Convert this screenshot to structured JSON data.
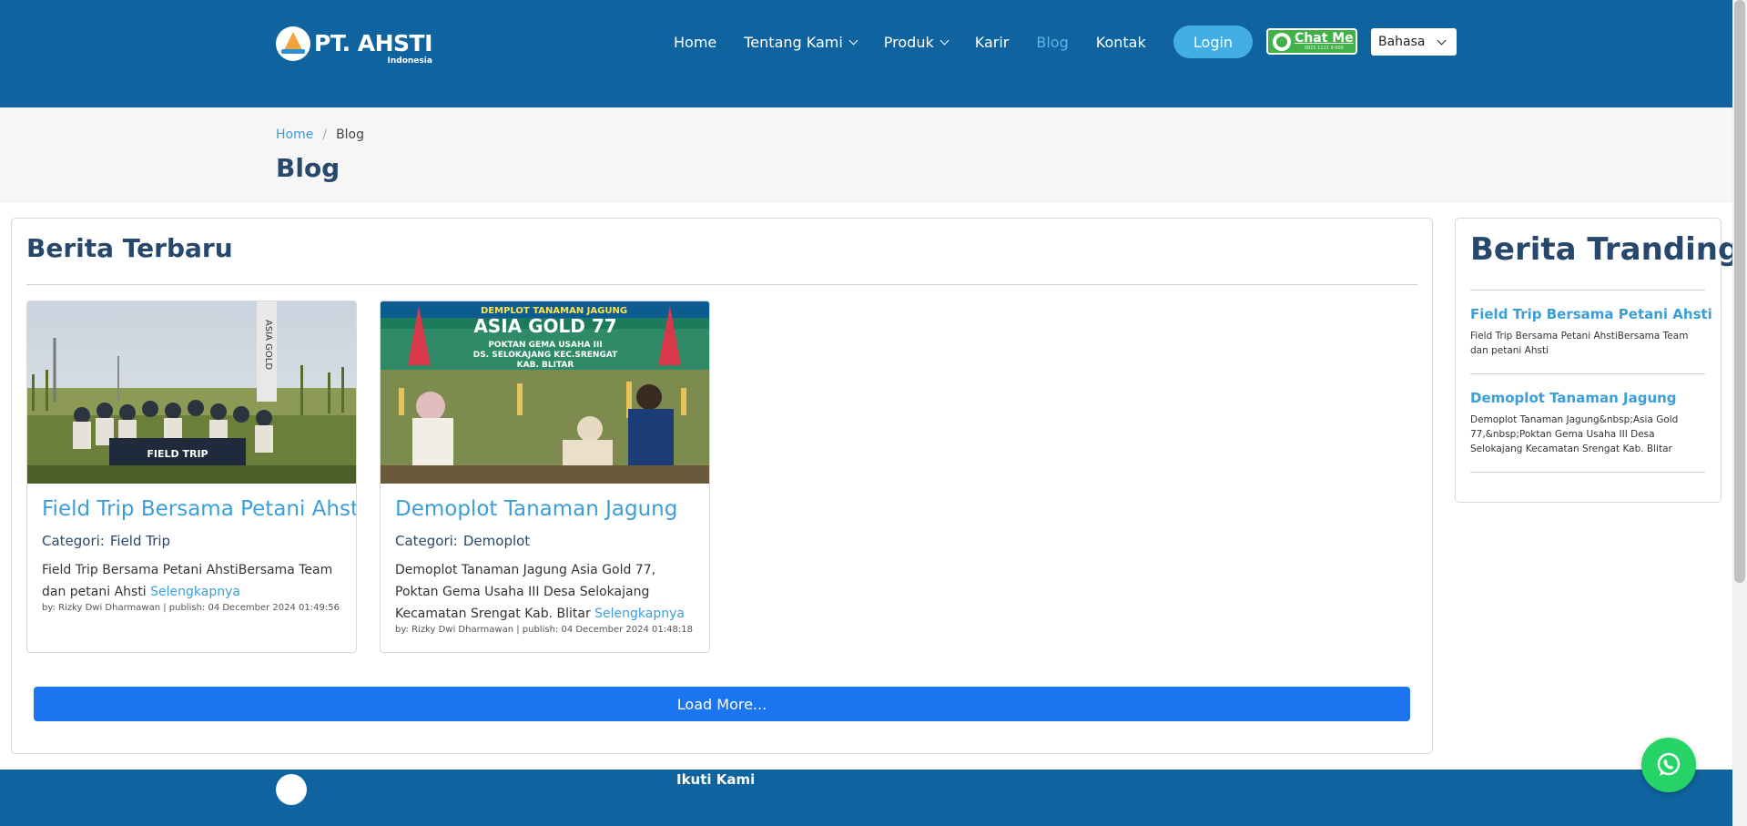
{
  "header": {
    "logo_text": "PT. AHSTI",
    "logo_sub": "Indonesia",
    "nav": [
      {
        "label": "Home"
      },
      {
        "label": "Tentang Kami"
      },
      {
        "label": "Produk"
      },
      {
        "label": "Karir"
      },
      {
        "label": "Blog"
      },
      {
        "label": "Kontak"
      }
    ],
    "login_label": "Login",
    "chat_label": "Chat Me",
    "chat_sub": "0821 1111 9 000",
    "lang_label": "Bahasa"
  },
  "breadcrumb": {
    "home": "Home",
    "current": "Blog"
  },
  "page_title": "Blog",
  "main": {
    "section_title": "Berita Terbaru",
    "cards": [
      {
        "title": "Field Trip Bersama Petani Ahsti",
        "category_label": "Categori:",
        "category": "Field Trip",
        "excerpt": "Field Trip Bersama Petani AhstiBersama Team dan petani Ahsti",
        "more": "Selengkapnya",
        "meta": "by: Rizky Dwi Dharmawan | publish: 04 December 2024 01:49:56",
        "image_banner": "FIELD TRIP"
      },
      {
        "title": "Demoplot Tanaman Jagung",
        "category_label": "Categori:",
        "category": "Demoplot",
        "excerpt": "Demoplot Tanaman Jagung Asia Gold 77, Poktan Gema Usaha III Desa Selokajang Kecamatan Srengat Kab. Blitar",
        "more": "Selengkapnya",
        "meta": "by: Rizky Dwi Dharmawan | publish: 04 December 2024 01:48:18",
        "image_banner": {
          "line1": "DEMPLOT TANAMAN JAGUNG",
          "line2": "ASIA GOLD 77",
          "line3": "POKTAN GEMA USAHA III",
          "line4": "DS. SELOKAJANG KEC.SRENGAT",
          "line5": "KAB. BLITAR"
        }
      }
    ],
    "load_more": "Load More..."
  },
  "sidebar": {
    "title": "Berita Tranding",
    "items": [
      {
        "title": "Field Trip Bersama Petani Ahsti",
        "desc": "Field Trip Bersama Petani AhstiBersama Team dan petani Ahsti"
      },
      {
        "title": "Demoplot Tanaman Jagung",
        "desc": "Demoplot Tanaman Jagung&nbsp;Asia Gold 77,&nbsp;Poktan Gema Usaha III Desa Selokajang Kecamatan Srengat Kab. Blitar"
      }
    ]
  },
  "footer": {
    "follow_label": "Ikuti Kami"
  },
  "colors": {
    "header_bg": "#0f64a0",
    "title_navy": "#27476c",
    "link_blue": "#3b9ed8",
    "button_blue": "#1b74f0",
    "whatsapp_green": "#25d366"
  },
  "icons": {
    "whatsapp": "whatsapp-icon",
    "chevron": "chevron-down-icon"
  }
}
